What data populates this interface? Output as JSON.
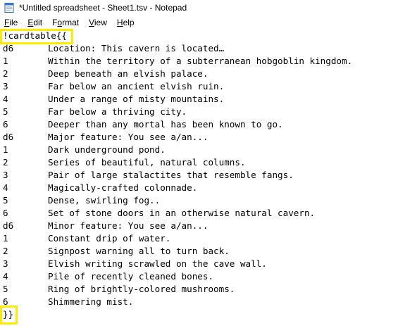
{
  "window": {
    "title": "*Untitled spreadsheet - Sheet1.tsv - Notepad",
    "app_icon": "notepad-icon",
    "highlight_color": "#ffeb00"
  },
  "menu": {
    "items": [
      {
        "label": "File",
        "underline": "F",
        "rest": "ile"
      },
      {
        "label": "Edit",
        "underline": "E",
        "rest": "dit"
      },
      {
        "label": "Format",
        "underline": "o",
        "pre": "F",
        "rest": "rmat"
      },
      {
        "label": "View",
        "underline": "V",
        "rest": "iew"
      },
      {
        "label": "Help",
        "underline": "H",
        "rest": "elp"
      }
    ]
  },
  "editor": {
    "first_line": "!cardtable{{",
    "last_line": "}}",
    "rows": [
      {
        "key": "d6",
        "text": "Location: This cavern is located…"
      },
      {
        "key": "1",
        "text": "Within the territory of a subterranean hobgoblin kingdom."
      },
      {
        "key": "2",
        "text": "Deep beneath an elvish palace."
      },
      {
        "key": "3",
        "text": "Far below an ancient elvish ruin."
      },
      {
        "key": "4",
        "text": "Under a range of misty mountains."
      },
      {
        "key": "5",
        "text": "Far below a thriving city."
      },
      {
        "key": "6",
        "text": "Deeper than any mortal has been known to go."
      },
      {
        "key": "d6",
        "text": "Major feature: You see a/an..."
      },
      {
        "key": "1",
        "text": "Dark underground pond."
      },
      {
        "key": "2",
        "text": "Series of beautiful, natural columns."
      },
      {
        "key": "3",
        "text": "Pair of large stalactites that resemble fangs."
      },
      {
        "key": "4",
        "text": "Magically-crafted colonnade."
      },
      {
        "key": "5",
        "text": "Dense, swirling fog.."
      },
      {
        "key": "6",
        "text": "Set of stone doors in an otherwise natural cavern."
      },
      {
        "key": "d6",
        "text": "Minor feature: You see a/an..."
      },
      {
        "key": "1",
        "text": "Constant drip of water."
      },
      {
        "key": "2",
        "text": "Signpost warning all to turn back."
      },
      {
        "key": "3",
        "text": "Elvish writing scrawled on the cave wall."
      },
      {
        "key": "4",
        "text": "Pile of recently cleaned bones."
      },
      {
        "key": "5",
        "text": "Ring of brightly-colored mushrooms."
      },
      {
        "key": "6",
        "text": "Shimmering mist."
      }
    ]
  }
}
